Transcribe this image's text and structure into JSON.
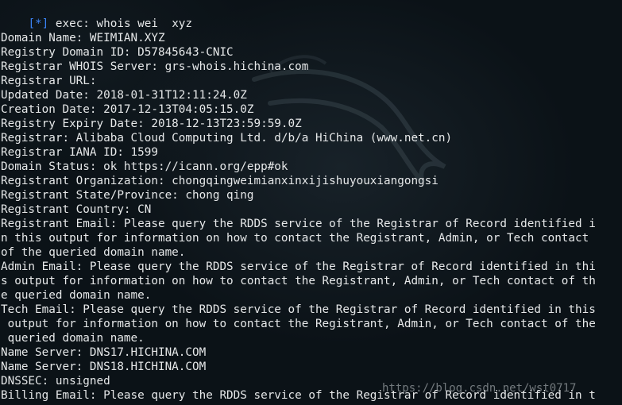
{
  "prompt": {
    "marker": "[*]",
    "command": " exec: whois wei  xyz"
  },
  "output_lines": [
    "Domain Name: WEIMIAN.XYZ",
    "Registry Domain ID: D57845643-CNIC",
    "Registrar WHOIS Server: grs-whois.hichina.com",
    "Registrar URL:",
    "Updated Date: 2018-01-31T12:11:24.0Z",
    "Creation Date: 2017-12-13T04:05:15.0Z",
    "Registry Expiry Date: 2018-12-13T23:59:59.0Z",
    "Registrar: Alibaba Cloud Computing Ltd. d/b/a HiChina (www.net.cn)",
    "Registrar IANA ID: 1599",
    "Domain Status: ok https://icann.org/epp#ok",
    "Registrant Organization: chongqingweimianxinxijishuyouxiangongsi",
    "Registrant State/Province: chong qing",
    "Registrant Country: CN",
    "Registrant Email: Please query the RDDS service of the Registrar of Record identified i",
    "n this output for information on how to contact the Registrant, Admin, or Tech contact",
    "of the queried domain name.",
    "Admin Email: Please query the RDDS service of the Registrar of Record identified in thi",
    "s output for information on how to contact the Registrant, Admin, or Tech contact of th",
    "e queried domain name.",
    "Tech Email: Please query the RDDS service of the Registrar of Record identified in this",
    " output for information on how to contact the Registrant, Admin, or Tech contact of the",
    " queried domain name.",
    "Name Server: DNS17.HICHINA.COM",
    "Name Server: DNS18.HICHINA.COM",
    "DNSSEC: unsigned",
    "Billing Email: Please query the RDDS service of the Registrar of Record identified in t"
  ],
  "watermark": "https://blog.csdn.net/wst0717",
  "colors": {
    "background": "#0b1217",
    "text": "#e6e8e9",
    "prompt_marker": "#3b83f6"
  }
}
